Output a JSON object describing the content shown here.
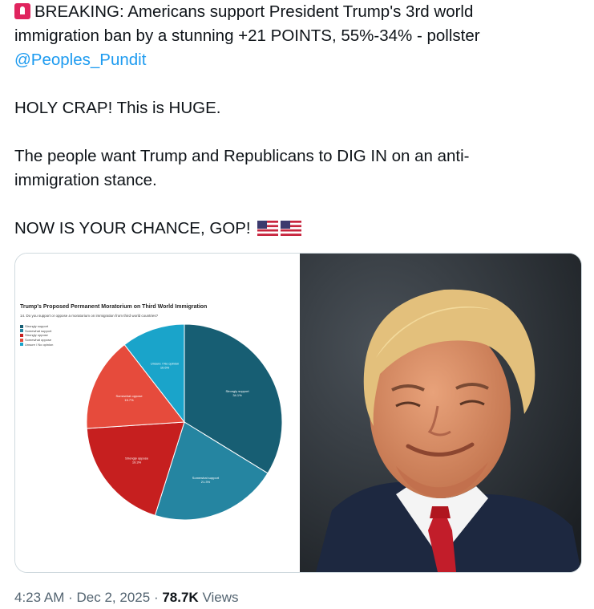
{
  "tweet": {
    "line1": "BREAKING: Americans support President Trump's 3rd world",
    "line2": "immigration ban by a stunning +21 POINTS, 55%-34% - pollster",
    "mention": "@Peoples_Pundit",
    "para2": "HOLY CRAP! This is HUGE.",
    "para3_line1": "The people want Trump and Republicans to DIG IN on an anti-",
    "para3_line2": "immigration stance.",
    "para4": "NOW IS YOUR CHANCE, GOP!",
    "emoji_icons": [
      "police-light-icon",
      "us-flag-icon",
      "us-flag-icon"
    ]
  },
  "media": {
    "photo_alt": "Photo of Donald Trump smiling"
  },
  "chart_data": {
    "type": "pie",
    "title": "Trump's Proposed Permanent Moratorium on Third World Immigration",
    "subtitle": "14. Do you support or oppose a moratorium on immigration from third world countries?",
    "categories": [
      "Strongly support",
      "Somewhat support",
      "Strongly oppose",
      "Somewhat oppose",
      "Unsure / No opinion"
    ],
    "values": [
      34.1,
      21.3,
      19.3,
      15.7,
      10.6
    ],
    "colors": [
      "#175e73",
      "#2585a1",
      "#c61f1f",
      "#e64b3c",
      "#1aa4ca"
    ],
    "legend_placement": "top-left"
  },
  "footer": {
    "time": "4:23 AM",
    "separator": "·",
    "date": "Dec 2, 2025",
    "views_count": "78.7K",
    "views_label": "Views"
  }
}
